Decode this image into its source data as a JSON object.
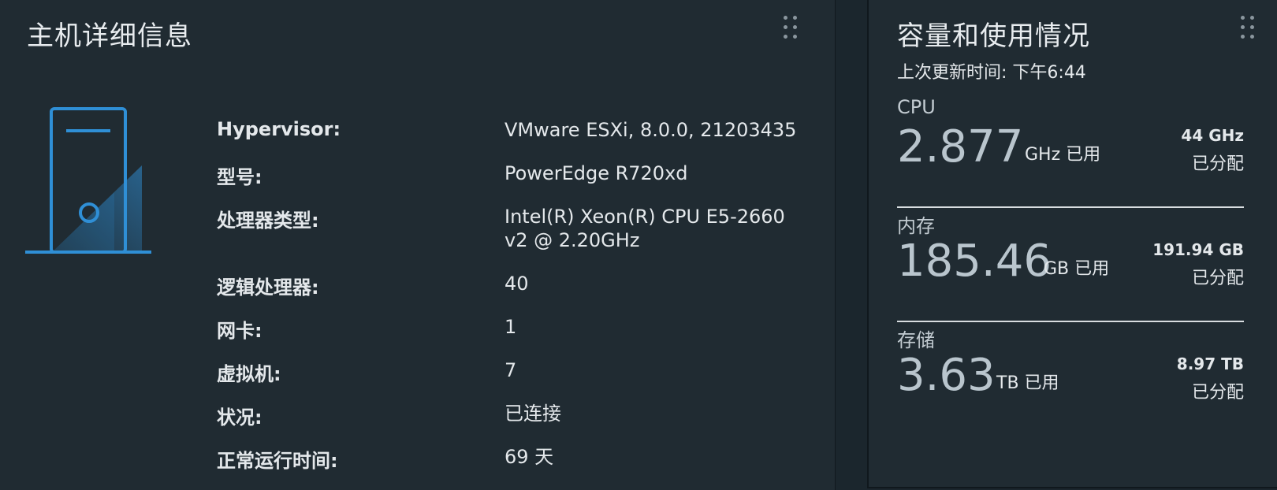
{
  "host_card": {
    "title": "主机详细信息",
    "properties": [
      {
        "label": "Hypervisor:",
        "value": "VMware ESXi, 8.0.0, 21203435"
      },
      {
        "label": "型号:",
        "value": "PowerEdge R720xd"
      },
      {
        "label": "处理器类型:",
        "value": "Intel(R) Xeon(R) CPU E5-2660 v2 @ 2.20GHz"
      },
      {
        "label": "逻辑处理器:",
        "value": "40"
      },
      {
        "label": "网卡:",
        "value": "1"
      },
      {
        "label": "虚拟机:",
        "value": "7"
      },
      {
        "label": "状况:",
        "value": "已连接"
      },
      {
        "label": "正常运行时间:",
        "value": "69 天"
      }
    ],
    "icon": "server-tower-icon",
    "icon_color": "#2f8fd6"
  },
  "capacity_card": {
    "title": "容量和使用情况",
    "last_updated": "上次更新时间: 下午6:44",
    "metrics": [
      {
        "name": "CPU",
        "used": "2.877",
        "used_unit": "GHz 已用",
        "capacity": "44 GHz",
        "capacity_label": "已分配"
      },
      {
        "name": "内存",
        "used": "185.46",
        "used_unit": "GB 已用",
        "capacity": "191.94 GB",
        "capacity_label": "已分配"
      },
      {
        "name": "存储",
        "used": "3.63",
        "used_unit": "TB 已用",
        "capacity": "8.97 TB",
        "capacity_label": "已分配"
      }
    ]
  }
}
